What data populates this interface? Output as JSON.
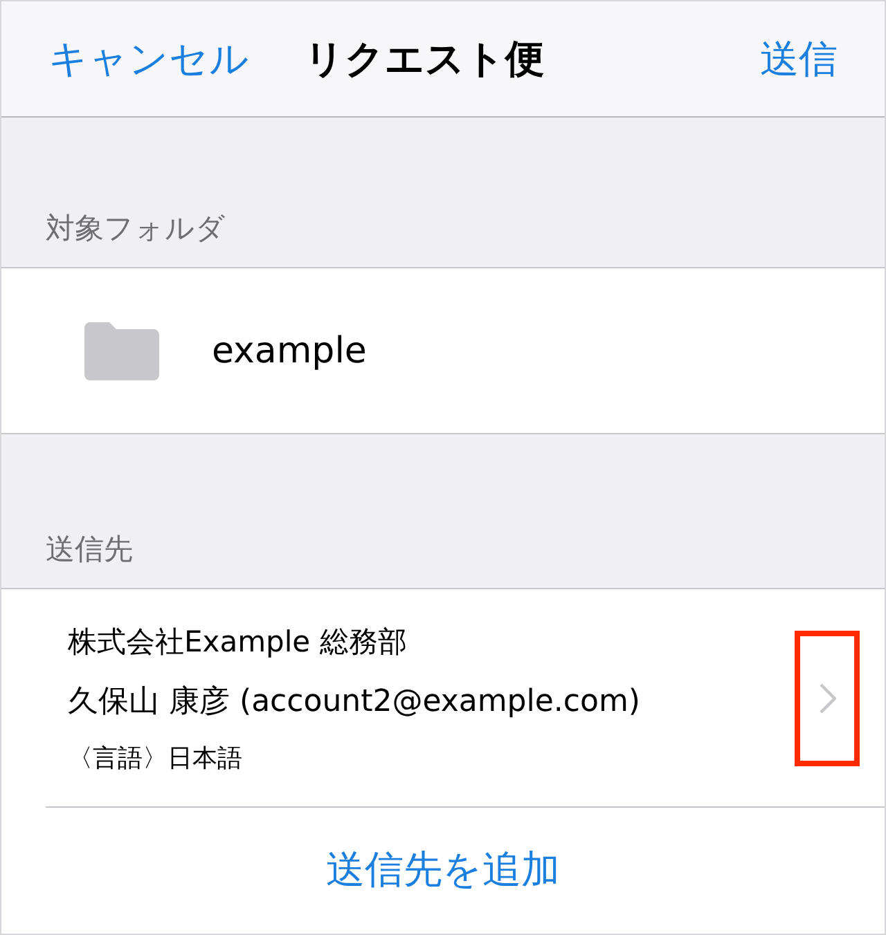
{
  "nav_bar": {
    "cancel": "キャンセル",
    "title": "リクエスト便",
    "send": "送信"
  },
  "folder_section": {
    "header": "対象フォルダ",
    "folder": {
      "name": "example"
    }
  },
  "recipient_section": {
    "header": "送信先",
    "recipients": [
      {
        "organization": "株式会社Example 総務部",
        "person": "久保山 康彦 (account2@example.com)",
        "language": "〈言語〉日本語",
        "highlighted": true
      }
    ],
    "add_button": "送信先を追加"
  }
}
